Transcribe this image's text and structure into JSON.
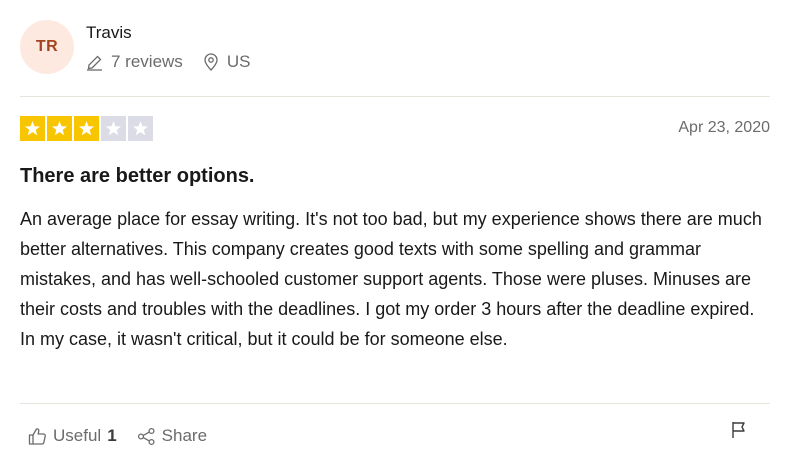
{
  "reviewer": {
    "initials": "TR",
    "name": "Travis",
    "reviews_count": "7 reviews",
    "country": "US",
    "avatar_bg": "#fde9df",
    "avatar_fg": "#a4431f"
  },
  "review": {
    "rating": 3,
    "rating_max": 5,
    "star_color": "#f7c600",
    "date": "Apr 23, 2020",
    "title": "There are better options.",
    "body": "An average place for essay writing. It's not too bad, but my experience shows there are much better alternatives. This company creates good texts with some spelling and grammar mistakes, and has well-schooled customer support agents. Those were pluses. Minuses are their costs and troubles with the deadlines. I got my order 3 hours after the deadline expired. In my case, it wasn't critical, but it could be for someone else."
  },
  "footer": {
    "useful_label": "Useful",
    "useful_count": "1",
    "share_label": "Share"
  },
  "icons": {
    "reviews": "pencil-icon",
    "location": "location-pin-icon",
    "star": "star-icon",
    "useful": "thumbs-up-icon",
    "share": "share-icon",
    "report": "flag-icon"
  }
}
